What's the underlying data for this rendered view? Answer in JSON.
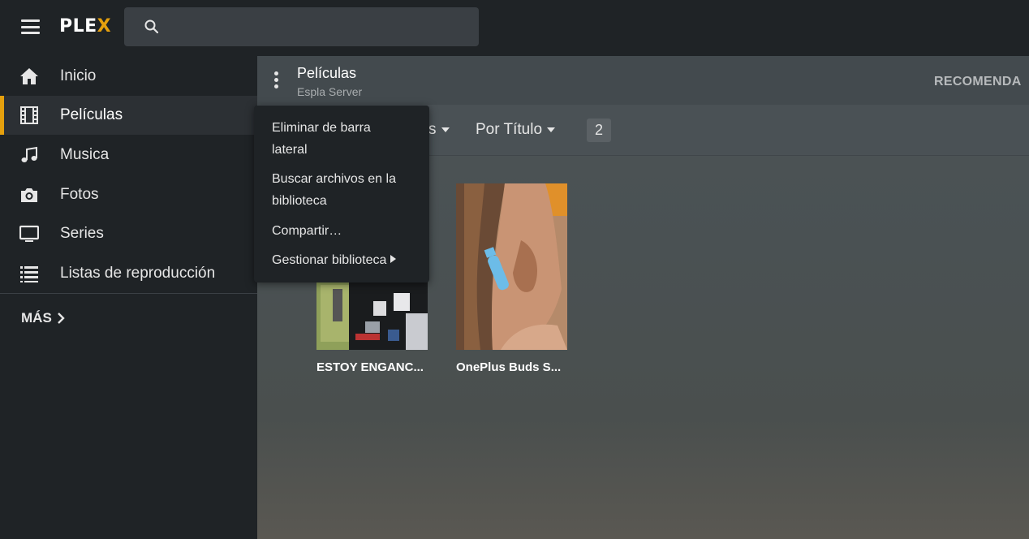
{
  "app": {
    "logo_main": "PLE",
    "logo_accent": "X",
    "accent_color": "#e5a00d"
  },
  "search": {
    "icon": "search-icon"
  },
  "sidebar": {
    "items": [
      {
        "label": "Inicio",
        "icon": "home-icon"
      },
      {
        "label": "Películas",
        "icon": "film-icon",
        "active": true
      },
      {
        "label": "Musica",
        "icon": "music-icon"
      },
      {
        "label": "Fotos",
        "icon": "camera-icon"
      },
      {
        "label": "Series",
        "icon": "tv-icon"
      },
      {
        "label": "Listas de reproducción",
        "icon": "list-icon"
      }
    ],
    "more_label": "MÁS"
  },
  "library": {
    "title": "Películas",
    "server": "Espla Server",
    "tab_recommended": "RECOMENDA",
    "filter_partial": "s",
    "sort_label": "Por Título",
    "count": "2"
  },
  "context_menu": {
    "items": [
      {
        "label_line1": "Eliminar de barra",
        "label_line2": "lateral"
      },
      {
        "label_line1": "Buscar archivos en la",
        "label_line2": "biblioteca"
      },
      {
        "label_line1": "Compartir…"
      },
      {
        "label_line1": "Gestionar biblioteca",
        "has_submenu": true
      }
    ]
  },
  "items": [
    {
      "title": "ESTOY ENGANC..."
    },
    {
      "title": "OnePlus Buds S..."
    }
  ]
}
